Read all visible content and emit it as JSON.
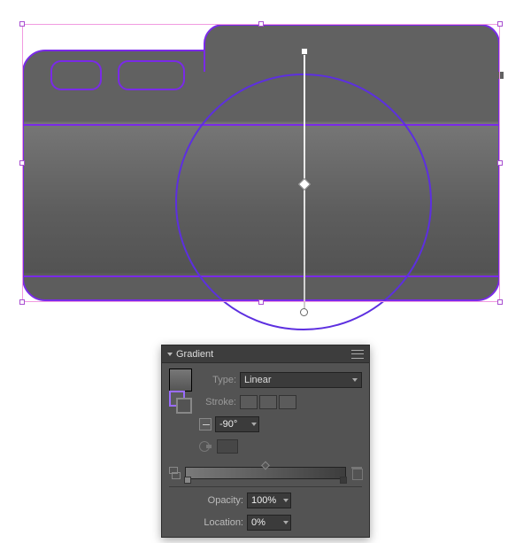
{
  "panel": {
    "title": "Gradient",
    "type_label": "Type:",
    "type_value": "Linear",
    "stroke_label": "Stroke:",
    "angle_value": "-90°",
    "opacity_label": "Opacity:",
    "opacity_value": "100%",
    "location_label": "Location:",
    "location_value": "0%"
  },
  "artwork": {
    "selection_color": "#f19ae0",
    "path_color": "#7a2ae8",
    "gradient_angle": -90,
    "chart_data": {
      "type": "gradient",
      "direction": "linear",
      "angle_deg": -90,
      "stops": [
        {
          "location_pct": 0,
          "opacity_pct": 100,
          "color": "#7a7a7a"
        },
        {
          "location_pct": 100,
          "opacity_pct": 100,
          "color": "#3d3d3d"
        }
      ]
    }
  }
}
